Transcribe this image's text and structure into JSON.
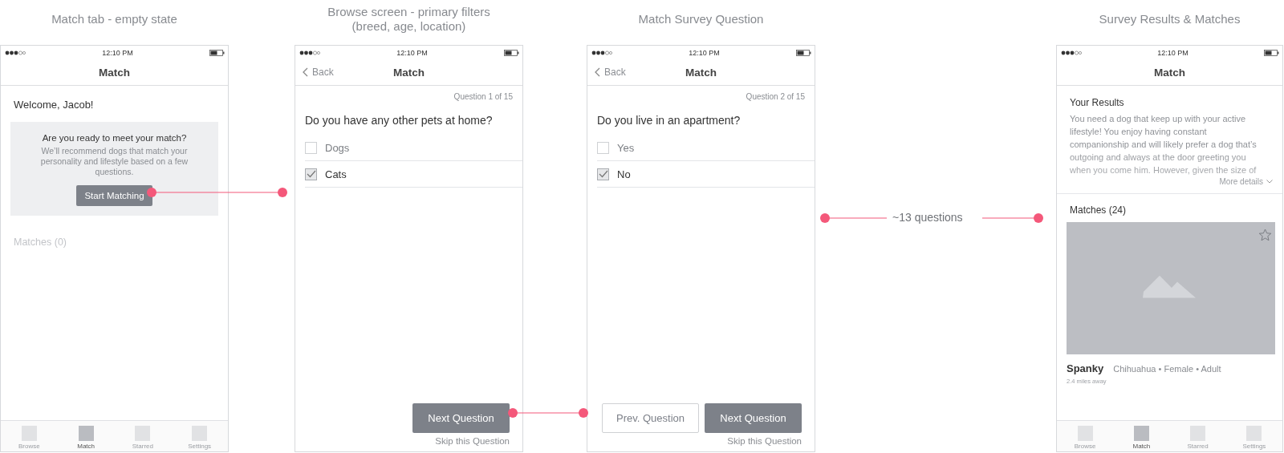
{
  "screens": [
    {
      "caption": "Match tab - empty state",
      "kind": "welcome",
      "time": "12:10 PM",
      "title": "Match",
      "greeting": "Welcome, Jacob!",
      "card": {
        "heading": "Are you ready to meet your match?",
        "text": "We’ll recommend dogs that match your personality and lifestyle based on a few questions.",
        "button": "Start Matching"
      },
      "matches": "Matches (0)",
      "tabs": [
        {
          "label": "Browse",
          "selected": false
        },
        {
          "label": "Match",
          "selected": true
        },
        {
          "label": "Starred",
          "selected": false
        },
        {
          "label": "Settings",
          "selected": false
        }
      ]
    },
    {
      "caption": "Browse screen - primary filters\n(breed, age, location)",
      "kind": "question",
      "time": "12:10 PM",
      "back": "Back",
      "title": "Match",
      "counter": "Question 1 of 15",
      "question": "Do you have any other pets at home?",
      "options": [
        {
          "label": "Dogs",
          "checked": false
        },
        {
          "label": "Cats",
          "checked": true
        }
      ],
      "buttons": [
        {
          "label": "Next Question",
          "kind": "primary"
        }
      ],
      "skip": "Skip this Question"
    },
    {
      "caption": "Match Survey Question",
      "kind": "question",
      "time": "12:10 PM",
      "back": "Back",
      "title": "Match",
      "counter": "Question 2 of 15",
      "question": "Do you live in an apartment?",
      "options": [
        {
          "label": "Yes",
          "checked": false
        },
        {
          "label": "No",
          "checked": true
        }
      ],
      "buttons": [
        {
          "label": "Prev. Question",
          "kind": "secondary"
        },
        {
          "label": "Next Question",
          "kind": "primary"
        }
      ],
      "skip": "Skip this Question"
    },
    {
      "caption": "Survey Results & Matches",
      "kind": "results",
      "time": "12:10 PM",
      "title": "Match",
      "results_heading": "Your Results",
      "results_text": "You need a dog that keep up with your active lifestyle! You enjoy having constant companionship and will likely prefer a dog that’s outgoing and always at the door greeting you when you come him. However, given the size of",
      "more": "More details",
      "matches": "Matches (24)",
      "match": {
        "name": "Spanky",
        "details": "Chihuahua • Female • Adult",
        "distance": "2.4 miles away"
      },
      "tabs": [
        {
          "label": "Browse",
          "selected": false
        },
        {
          "label": "Match",
          "selected": true
        },
        {
          "label": "Starred",
          "selected": false
        },
        {
          "label": "Settings",
          "selected": false
        }
      ]
    }
  ],
  "annotation": {
    "label": "~13 questions"
  }
}
